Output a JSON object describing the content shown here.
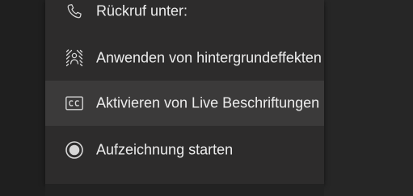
{
  "menu": {
    "items": [
      {
        "icon": "phone-icon",
        "label": "Rückruf unter:"
      },
      {
        "icon": "background-effects-icon",
        "label": "Anwenden von hintergrundeffekten"
      },
      {
        "icon": "closed-captions-icon",
        "label": "Aktivieren von Live Beschriftungen"
      },
      {
        "icon": "record-icon",
        "label": "Aufzeichnung starten"
      }
    ]
  },
  "colors": {
    "menu_background": "#2d2c2c",
    "hover_background": "#3b3a3a",
    "text": "#ececec",
    "icon": "#d6d6d6"
  }
}
